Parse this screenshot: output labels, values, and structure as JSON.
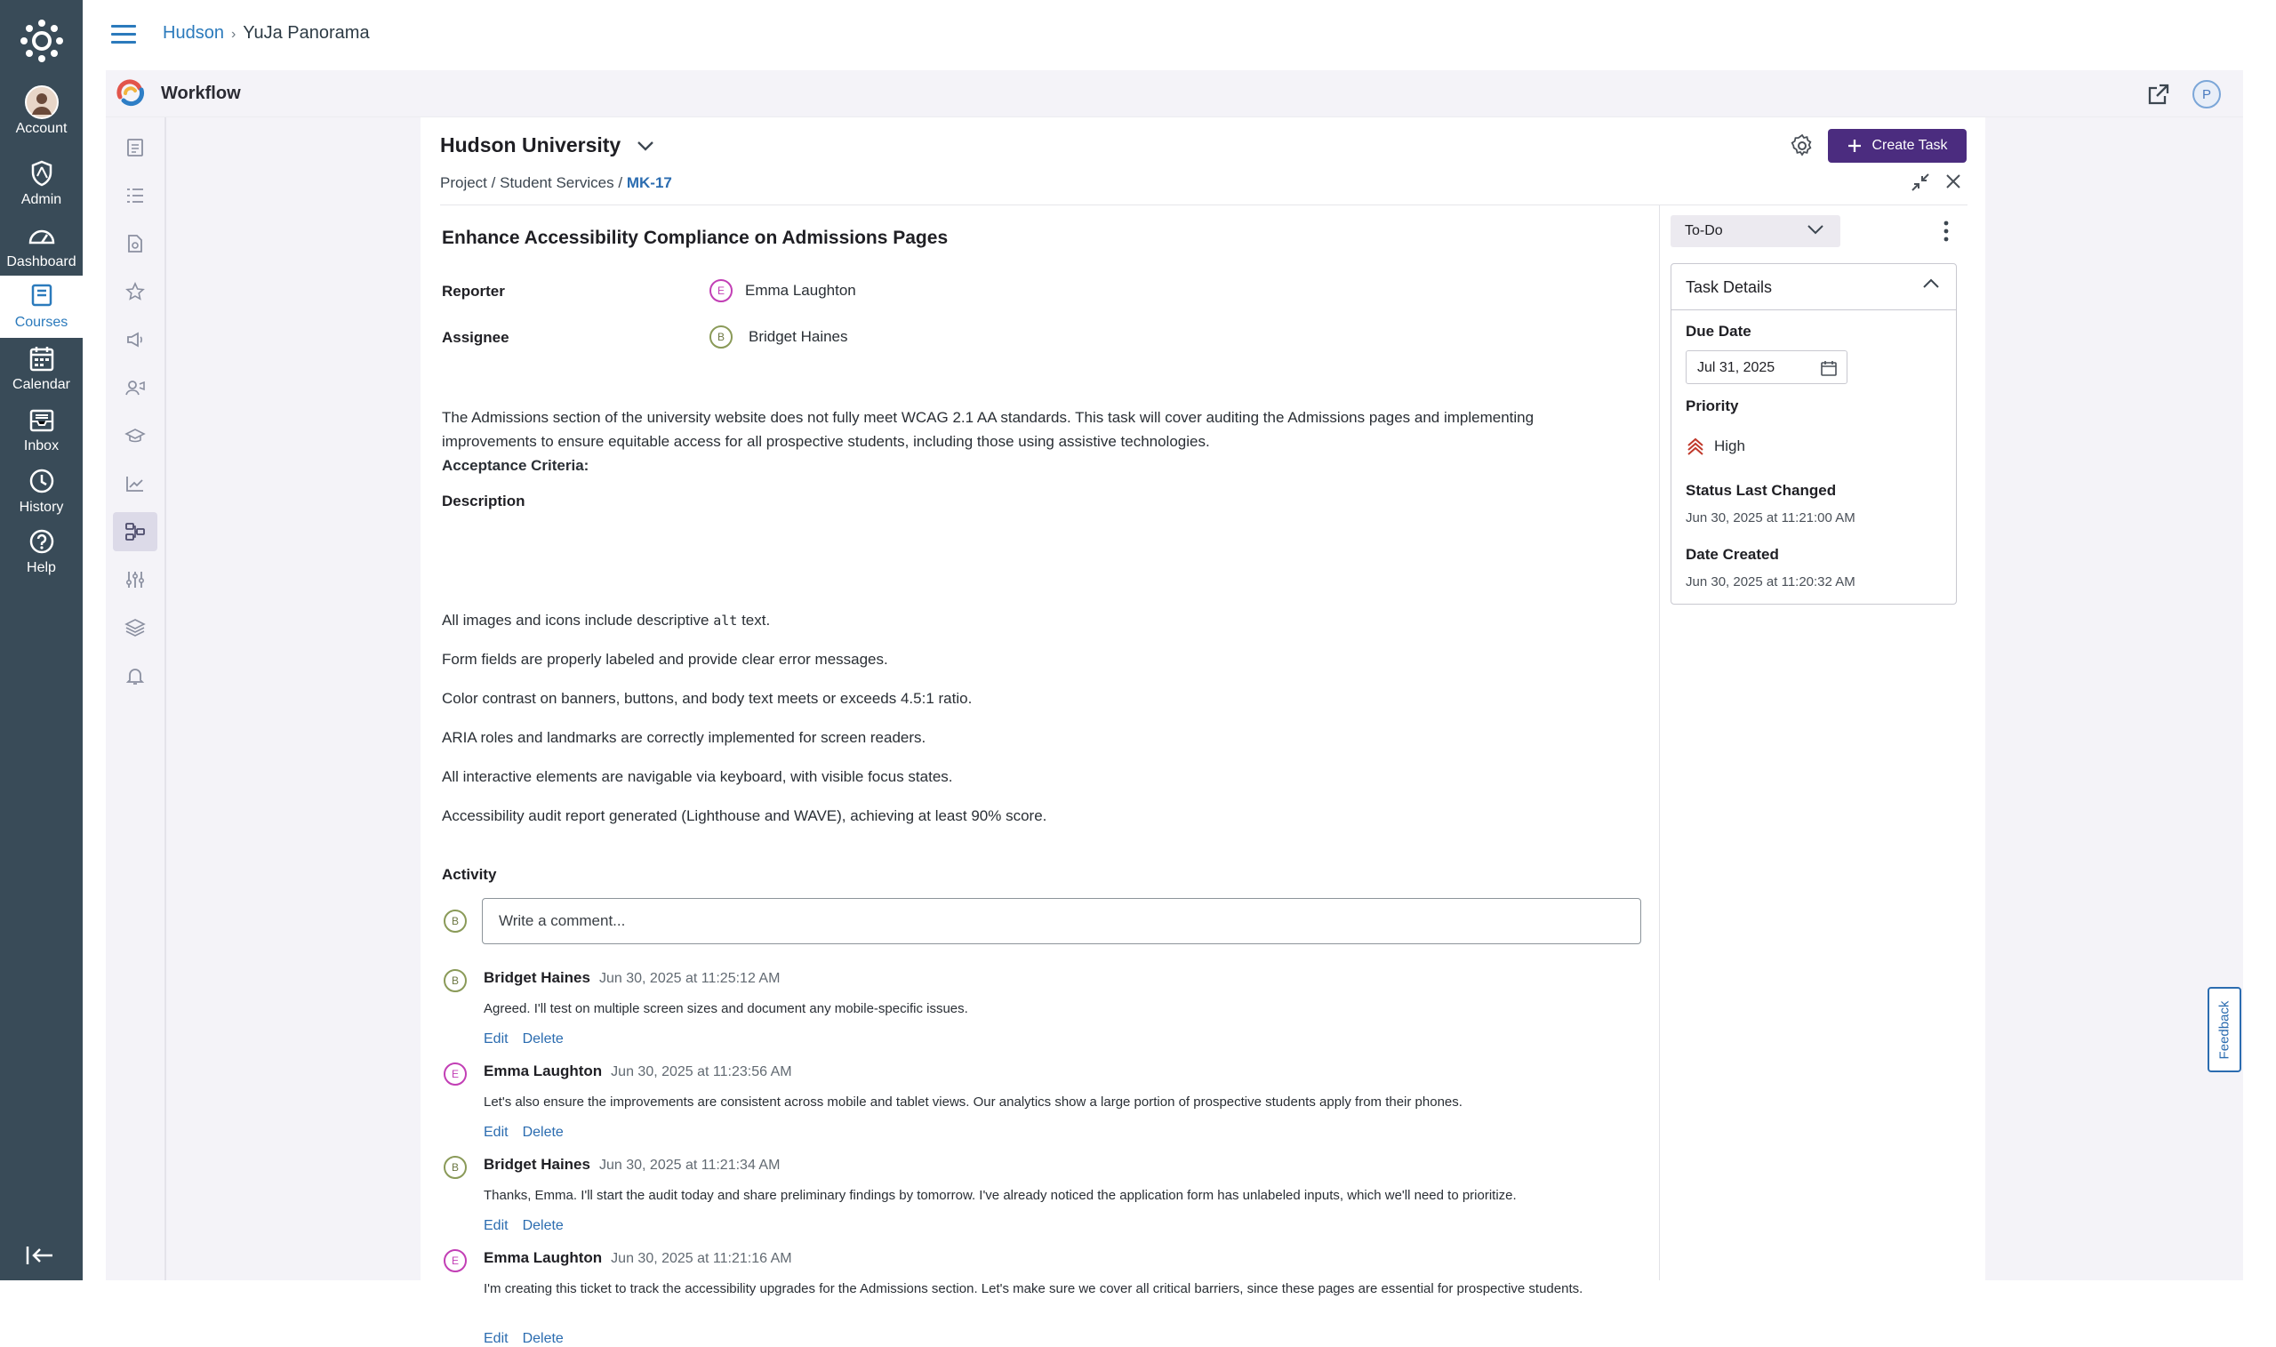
{
  "global_nav": {
    "items": [
      {
        "label": "Account",
        "icon": "avatar-icon"
      },
      {
        "label": "Admin",
        "icon": "shield-icon"
      },
      {
        "label": "Dashboard",
        "icon": "dashboard-icon"
      },
      {
        "label": "Courses",
        "icon": "book-icon"
      },
      {
        "label": "Calendar",
        "icon": "calendar-icon"
      },
      {
        "label": "Inbox",
        "icon": "inbox-icon"
      },
      {
        "label": "History",
        "icon": "clock-icon"
      },
      {
        "label": "Help",
        "icon": "question-icon"
      }
    ],
    "active": "Courses"
  },
  "breadcrumb": {
    "root": "Hudson",
    "current": "YuJa Panorama"
  },
  "workflow_bar": {
    "title": "Workflow",
    "user_initial": "P"
  },
  "panel": {
    "org_name": "Hudson University",
    "create_label": "Create Task",
    "crumbs": {
      "a": "Project",
      "b": "Student Services",
      "c": "MK-17",
      "sep": "/"
    }
  },
  "task": {
    "title": "Enhance Accessibility Compliance on Admissions Pages",
    "reporter_label": "Reporter",
    "reporter": {
      "initial": "E",
      "name": "Emma Laughton"
    },
    "assignee_label": "Assignee",
    "assignee": {
      "initial": "B",
      "name": "Bridget Haines"
    },
    "description_label": "Description",
    "description": "The Admissions section of the university website does not fully meet WCAG 2.1 AA standards. This task will cover auditing the Admissions pages and implementing improvements to ensure equitable access for all prospective students, including those using assistive technologies.",
    "criteria_label": "Acceptance Criteria:",
    "criteria": {
      "c1_pre": "All images and icons include descriptive",
      "c1_code": "alt",
      "c1_post": "text.",
      "c2": "Form fields are properly labeled and provide clear error messages.",
      "c3": "Color contrast on banners, buttons, and body text meets or exceeds 4.5:1 ratio.",
      "c4": "ARIA roles and landmarks are correctly implemented for screen readers.",
      "c5": "All interactive elements are navigable via keyboard, with visible focus states.",
      "c6": "Accessibility audit report generated (Lighthouse and WAVE), achieving at least 90% score."
    }
  },
  "activity": {
    "label": "Activity",
    "comment_initial": "B",
    "comment_placeholder": "Write a comment...",
    "edit_label": "Edit",
    "delete_label": "Delete",
    "comments": [
      {
        "initial": "B",
        "author": "Bridget Haines",
        "time": "Jun 30, 2025 at 11:25:12 AM",
        "text": "Agreed. I'll test on multiple screen sizes and document any mobile-specific issues."
      },
      {
        "initial": "E",
        "author": "Emma Laughton",
        "time": "Jun 30, 2025 at 11:23:56 AM",
        "text": "Let's also ensure the improvements are consistent across mobile and tablet views. Our analytics show a large portion of prospective students apply from their phones."
      },
      {
        "initial": "B",
        "author": "Bridget Haines",
        "time": "Jun 30, 2025 at 11:21:34 AM",
        "text": "Thanks, Emma. I'll start the audit today and share preliminary findings by tomorrow. I've already noticed the application form has unlabeled inputs, which we'll need to prioritize."
      },
      {
        "initial": "E",
        "author": "Emma Laughton",
        "time": "Jun 30, 2025 at 11:21:16 AM",
        "text": "I'm creating this ticket to track the accessibility upgrades for the Admissions section. Let's make sure we cover all critical barriers, since these pages are essential for prospective students."
      }
    ]
  },
  "sidebar": {
    "status": "To-Do",
    "details_title": "Task Details",
    "due_label": "Due Date",
    "due_value": "Jul 31, 2025",
    "priority_label": "Priority",
    "priority_value": "High",
    "status_changed_label": "Status Last Changed",
    "status_changed_value": "Jun 30, 2025 at 11:21:00 AM",
    "created_label": "Date Created",
    "created_value": "Jun 30, 2025 at 11:20:32 AM"
  },
  "feedback_label": "Feedback",
  "colors": {
    "nav_bg": "#394b58",
    "accent": "#4b2c7f",
    "link": "#2b6cb0",
    "priority": "#c0392b"
  }
}
